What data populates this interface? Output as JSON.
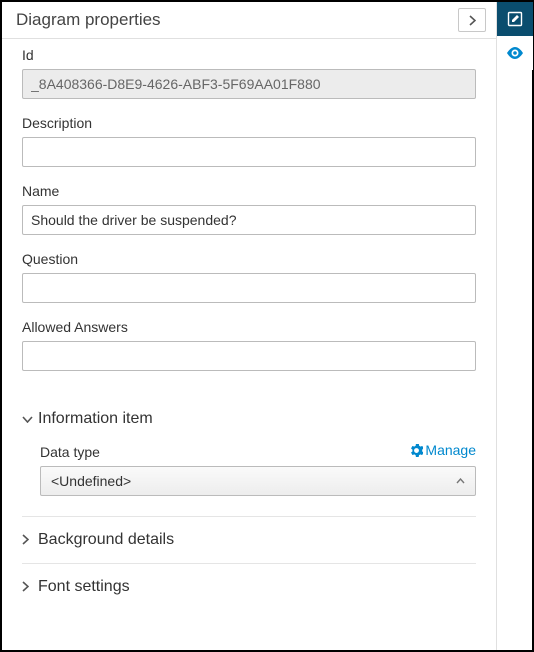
{
  "header": {
    "title": "Diagram properties"
  },
  "fields": {
    "id": {
      "label": "Id",
      "value": "_8A408366-D8E9-4626-ABF3-5F69AA01F880"
    },
    "description": {
      "label": "Description",
      "value": ""
    },
    "name": {
      "label": "Name",
      "value": "Should the driver be suspended?"
    },
    "question": {
      "label": "Question",
      "value": ""
    },
    "allowed_answers": {
      "label": "Allowed Answers",
      "value": ""
    }
  },
  "sections": {
    "information_item": {
      "title": "Information item",
      "expanded": true
    },
    "background_details": {
      "title": "Background details",
      "expanded": false
    },
    "font_settings": {
      "title": "Font settings",
      "expanded": false
    }
  },
  "data_type": {
    "label": "Data type",
    "manage_label": "Manage",
    "selected": "<Undefined>"
  }
}
